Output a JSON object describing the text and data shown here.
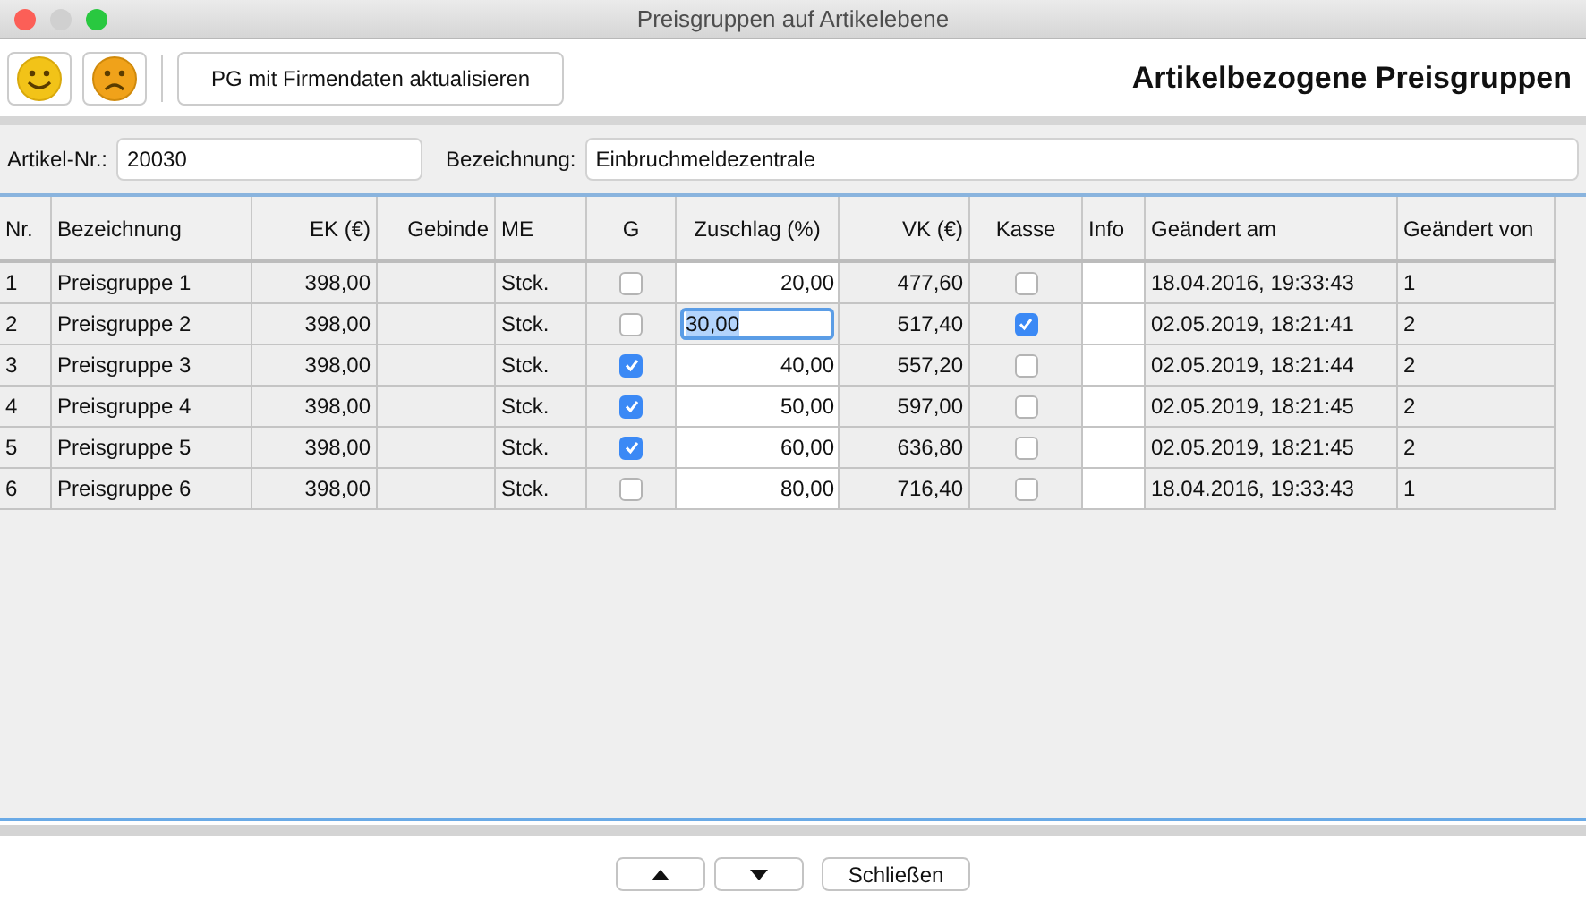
{
  "window": {
    "title": "Preisgruppen auf Artikelebene"
  },
  "toolbar": {
    "buttons": [
      {
        "kind": "happy"
      },
      {
        "kind": "sad"
      },
      {
        "kind": "text",
        "label": "PG mit Firmendaten aktualisieren"
      }
    ],
    "heading": "Artikelbezogene Preisgruppen"
  },
  "fields": [
    {
      "label": "Artikel-Nr.:",
      "value": "20030"
    },
    {
      "label": "Bezeichnung:",
      "value": "Einbruchmeldezentrale"
    }
  ],
  "table": {
    "columns": [
      "Nr.",
      "Bezeichnung",
      "EK (€)",
      "Gebinde",
      "ME",
      "G",
      "Zuschlag (%)",
      "VK (€)",
      "Kasse",
      "Info",
      "Geändert am",
      "Geändert von"
    ],
    "rows": [
      {
        "nr": "1",
        "name": "Preisgruppe 1",
        "ek": "398,00",
        "me": "Stck.",
        "g": false,
        "zuschlag": "20,00",
        "editing": false,
        "vk": "477,60",
        "kasse": false,
        "changed_at": "18.04.2016, 19:33:43",
        "changed_by": "1"
      },
      {
        "nr": "2",
        "name": "Preisgruppe 2",
        "ek": "398,00",
        "me": "Stck.",
        "g": false,
        "zuschlag": "30,00",
        "editing": true,
        "vk": "517,40",
        "kasse": true,
        "changed_at": "02.05.2019, 18:21:41",
        "changed_by": "2"
      },
      {
        "nr": "3",
        "name": "Preisgruppe 3",
        "ek": "398,00",
        "me": "Stck.",
        "g": true,
        "zuschlag": "40,00",
        "editing": false,
        "vk": "557,20",
        "kasse": false,
        "changed_at": "02.05.2019, 18:21:44",
        "changed_by": "2"
      },
      {
        "nr": "4",
        "name": "Preisgruppe 4",
        "ek": "398,00",
        "me": "Stck.",
        "g": true,
        "zuschlag": "50,00",
        "editing": false,
        "vk": "597,00",
        "kasse": false,
        "changed_at": "02.05.2019, 18:21:45",
        "changed_by": "2"
      },
      {
        "nr": "5",
        "name": "Preisgruppe 5",
        "ek": "398,00",
        "me": "Stck.",
        "g": true,
        "zuschlag": "60,00",
        "editing": false,
        "vk": "636,80",
        "kasse": false,
        "changed_at": "02.05.2019, 18:21:45",
        "changed_by": "2"
      },
      {
        "nr": "6",
        "name": "Preisgruppe 6",
        "ek": "398,00",
        "me": "Stck.",
        "g": false,
        "zuschlag": "80,00",
        "editing": false,
        "vk": "716,40",
        "kasse": false,
        "changed_at": "18.04.2016, 19:33:43",
        "changed_by": "1"
      }
    ]
  },
  "footer": {
    "buttons": [
      {
        "kind": "up"
      },
      {
        "kind": "down"
      },
      {
        "kind": "text",
        "label": "Schließen"
      }
    ]
  }
}
